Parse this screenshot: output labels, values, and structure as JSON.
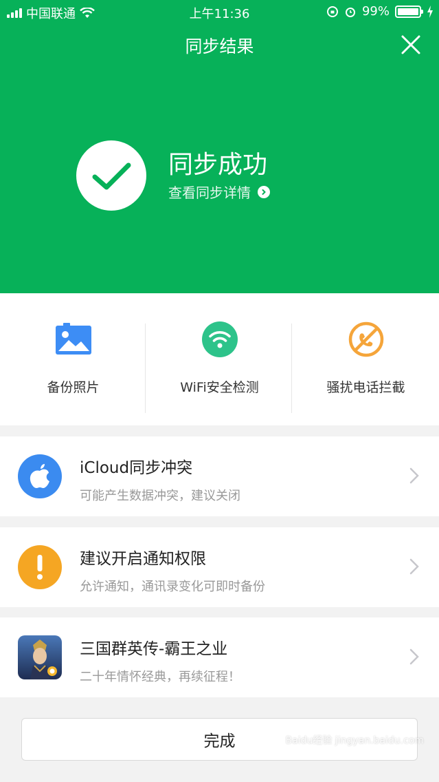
{
  "status_bar": {
    "carrier": "中国联通",
    "time": "上午11:36",
    "battery": "99%"
  },
  "header": {
    "title": "同步结果",
    "result_title": "同步成功",
    "result_link": "查看同步详情"
  },
  "tools": [
    {
      "label": "备份照片",
      "icon": "photo-icon",
      "color": "#3d8df5"
    },
    {
      "label": "WiFi安全检测",
      "icon": "wifi-icon",
      "color": "#2dc38a"
    },
    {
      "label": "骚扰电话拦截",
      "icon": "block-call-icon",
      "color": "#f5a53a"
    }
  ],
  "cards": [
    {
      "title": "iCloud同步冲突",
      "subtitle": "可能产生数据冲突，建议关闭",
      "icon": "apple-icon",
      "color": "#3b8bf0"
    },
    {
      "title": "建议开启通知权限",
      "subtitle": "允许通知，通讯录变化可即时备份",
      "icon": "exclamation-icon",
      "color": "#f5a623"
    },
    {
      "title": "三国群英传-霸王之业",
      "subtitle": "二十年情怀经典，再续征程！",
      "icon": "game-icon"
    }
  ],
  "footer": {
    "done_label": "完成"
  },
  "watermark": "Baidu经验 jingyan.baidu.com",
  "colors": {
    "brand_green": "#07b159"
  }
}
